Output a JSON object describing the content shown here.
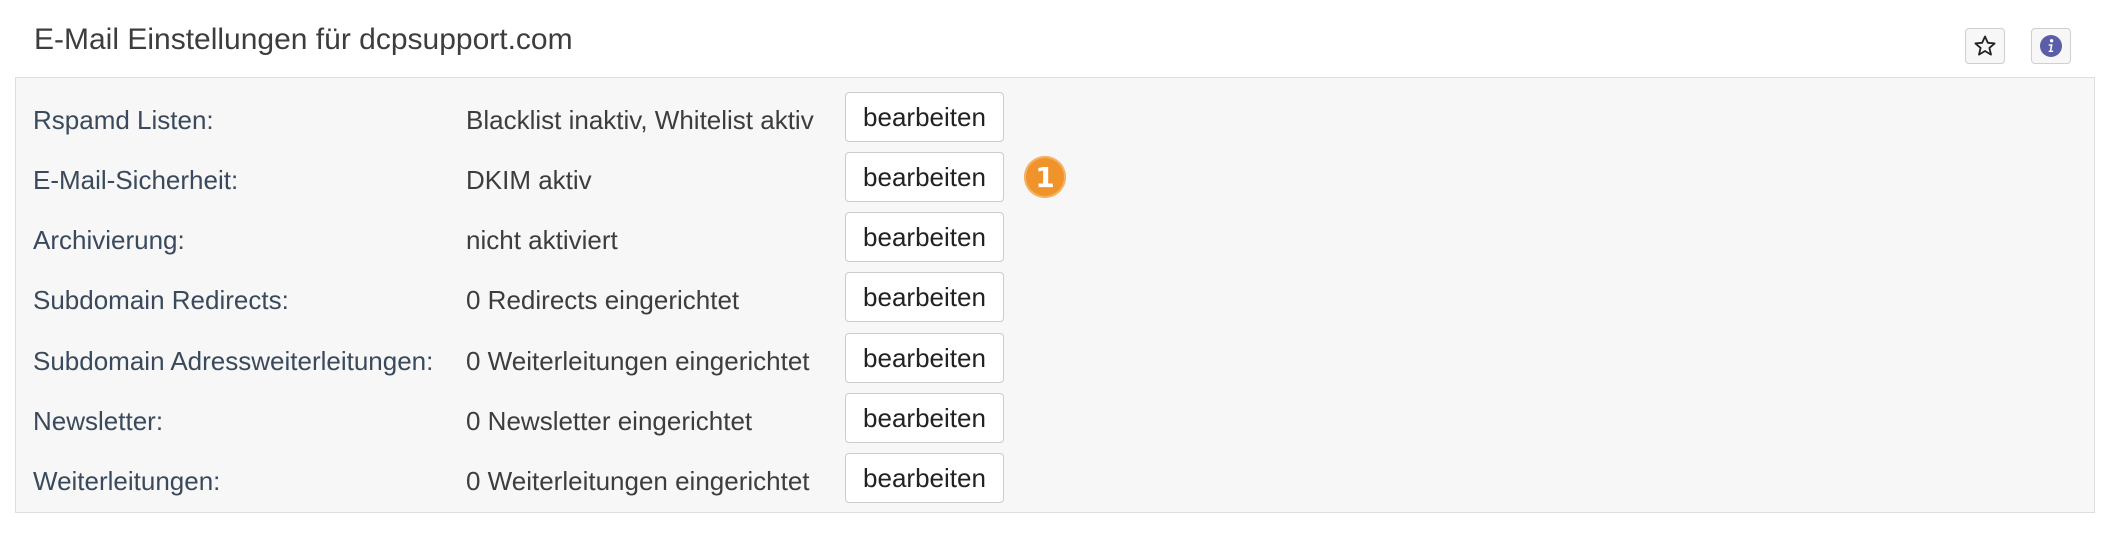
{
  "header": {
    "title": "E-Mail Einstellungen für dcpsupport.com",
    "star_icon": "star-icon",
    "info_icon": "info-icon"
  },
  "settings": {
    "rows": [
      {
        "label": "Rspamd Listen:",
        "value": "Blacklist inaktiv, Whitelist aktiv",
        "button": "bearbeiten"
      },
      {
        "label": "E-Mail-Sicherheit:",
        "value": "DKIM aktiv",
        "button": "bearbeiten",
        "marker": "1"
      },
      {
        "label": "Archivierung:",
        "value": "nicht aktiviert",
        "button": "bearbeiten"
      },
      {
        "label": "Subdomain Redirects:",
        "value": "0 Redirects eingerichtet",
        "button": "bearbeiten"
      },
      {
        "label": "Subdomain Adressweiterleitungen:",
        "value": "0 Weiterleitungen eingerichtet",
        "button": "bearbeiten"
      },
      {
        "label": "Newsletter:",
        "value": "0 Newsletter eingerichtet",
        "button": "bearbeiten"
      },
      {
        "label": "Weiterleitungen:",
        "value": "0 Weiterleitungen eingerichtet",
        "button": "bearbeiten"
      }
    ]
  },
  "colors": {
    "marker": "#f0932b",
    "info_icon": "#5a5ea8",
    "label_text": "#3a4a5c"
  }
}
